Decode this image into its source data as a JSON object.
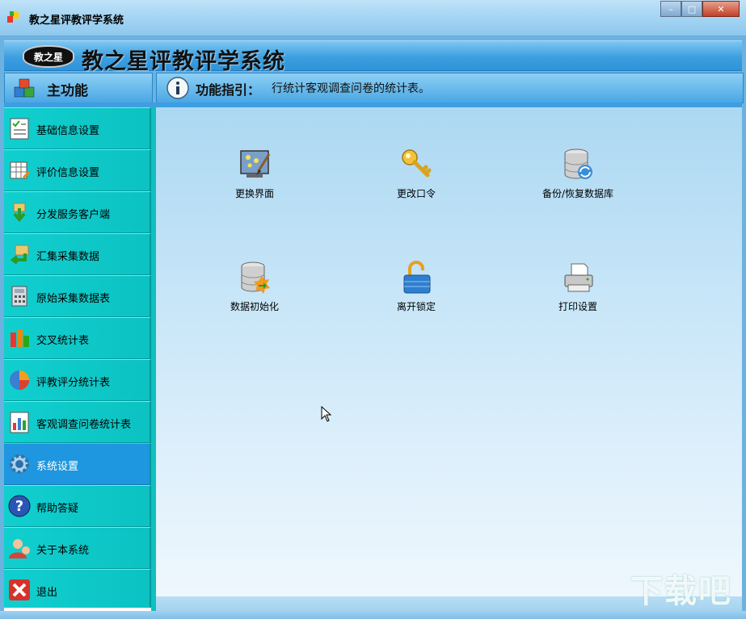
{
  "window": {
    "title": "教之星评教评学系统",
    "controls": {
      "minimize": "–",
      "maximize": "□",
      "close": "✕"
    }
  },
  "banner": {
    "logo_text": "教之星",
    "app_title": "教之星评教评学系统"
  },
  "menu_header": {
    "label": "主功能"
  },
  "guide": {
    "label": "功能指引：",
    "text": "行统计客观调查问卷的统计表。"
  },
  "sidebar": {
    "items": [
      {
        "label": "基础信息设置",
        "icon": "checklist-icon",
        "active": false
      },
      {
        "label": "评价信息设置",
        "icon": "grid-edit-icon",
        "active": false
      },
      {
        "label": "分发服务客户端",
        "icon": "download-arrow-icon",
        "active": false
      },
      {
        "label": "汇集采集数据",
        "icon": "collect-arrow-icon",
        "active": false
      },
      {
        "label": "原始采集数据表",
        "icon": "calculator-icon",
        "active": false
      },
      {
        "label": "交叉统计表",
        "icon": "cross-stats-icon",
        "active": false
      },
      {
        "label": "评教评分统计表",
        "icon": "pie-chart-icon",
        "active": false
      },
      {
        "label": "客观调查问卷统计表",
        "icon": "survey-chart-icon",
        "active": false
      },
      {
        "label": "系统设置",
        "icon": "gear-icon",
        "active": true
      },
      {
        "label": "帮助答疑",
        "icon": "help-icon",
        "active": false
      },
      {
        "label": "关于本系统",
        "icon": "user-icon",
        "active": false
      },
      {
        "label": "退出",
        "icon": "exit-icon",
        "active": false
      }
    ]
  },
  "functions": [
    {
      "label": "更换界面",
      "icon": "change-skin-icon"
    },
    {
      "label": "更改口令",
      "icon": "key-icon"
    },
    {
      "label": "备份/恢复数据库",
      "icon": "database-backup-icon"
    },
    {
      "label": "数据初始化",
      "icon": "database-init-icon"
    },
    {
      "label": "离开锁定",
      "icon": "lock-icon"
    },
    {
      "label": "打印设置",
      "icon": "printer-icon"
    }
  ],
  "watermark": "下载吧",
  "colors": {
    "sidebar_bg": "#08c7c7",
    "active_item": "#1e96e0",
    "banner": "#3d9fe0"
  }
}
